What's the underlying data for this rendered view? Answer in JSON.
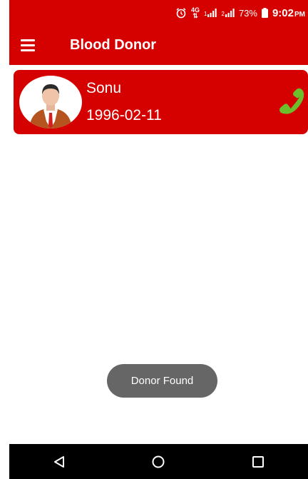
{
  "status_bar": {
    "network_label": "4G",
    "sim1_label": "1",
    "sim2_label": "2",
    "battery": "73%",
    "time": "9:02",
    "ampm": "PM"
  },
  "app_bar": {
    "title": "Blood Donor"
  },
  "donors": [
    {
      "name": "Sonu",
      "date": "1996-02-11"
    }
  ],
  "toast": {
    "message": "Donor Found"
  },
  "colors": {
    "primary": "#d50000",
    "call_icon": "#6cbf2a",
    "toast_bg": "#666666"
  }
}
